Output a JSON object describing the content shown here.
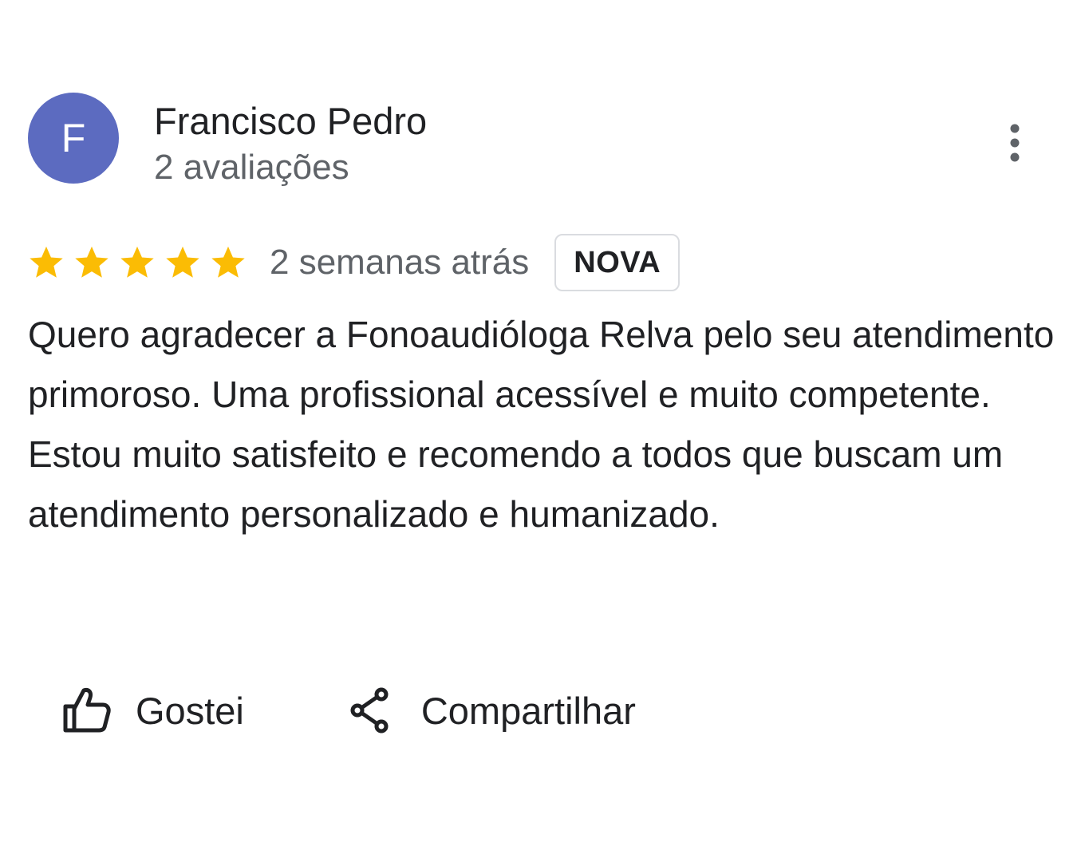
{
  "reviewer": {
    "initial": "F",
    "name": "Francisco Pedro",
    "review_count": "2 avaliações",
    "avatar_color": "#5c6bc0"
  },
  "rating": {
    "stars": 5,
    "max_stars": 5,
    "star_color": "#fbbc04",
    "date": "2 semanas atrás",
    "badge": "NOVA"
  },
  "review": {
    "text": "Quero agradecer a Fonoaudióloga Relva pelo seu atendimento primoroso. Uma profissional acessível e muito competente. Estou muito satisfeito e recomendo a todos que buscam um atendimento personalizado e humanizado."
  },
  "actions": {
    "like_label": "Gostei",
    "like_icon": "thumbs-up-icon",
    "share_label": "Compartilhar",
    "share_icon": "share-icon",
    "more_icon": "more-vert-icon"
  }
}
